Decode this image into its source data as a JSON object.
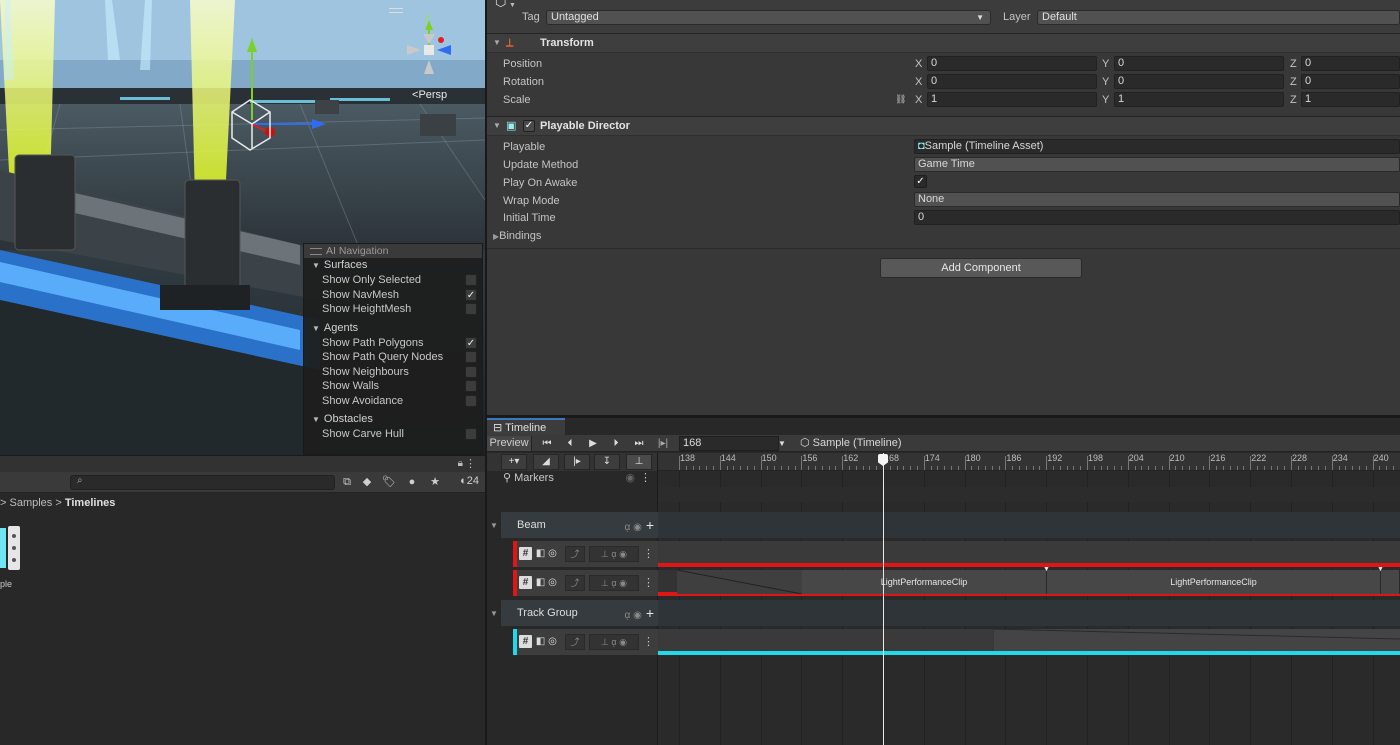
{
  "scene": {
    "persp_label": "Persp",
    "gizmo_axis_label": "y"
  },
  "ai_navigation": {
    "title": "AI Navigation",
    "sections": [
      {
        "label": "Surfaces",
        "rows": [
          {
            "label": "Show Only Selected",
            "checked": false
          },
          {
            "label": "Show NavMesh",
            "checked": true
          },
          {
            "label": "Show HeightMesh",
            "checked": false
          }
        ]
      },
      {
        "label": "Agents",
        "rows": [
          {
            "label": "Show Path Polygons",
            "checked": true
          },
          {
            "label": "Show Path Query Nodes",
            "checked": false
          },
          {
            "label": "Show Neighbours",
            "checked": false
          },
          {
            "label": "Show Walls",
            "checked": false
          },
          {
            "label": "Show Avoidance",
            "checked": false
          }
        ]
      },
      {
        "label": "Obstacles",
        "rows": [
          {
            "label": "Show Carve Hull",
            "checked": false
          }
        ]
      }
    ]
  },
  "project": {
    "search_placeholder": "",
    "hidden_count": "24",
    "breadcrumb": {
      "parent": "Samples",
      "current": "Timelines"
    },
    "asset_label": "ple"
  },
  "inspector": {
    "tag_label": "Tag",
    "tag_value": "Untagged",
    "layer_label": "Layer",
    "layer_value": "Default",
    "transform": {
      "title": "Transform",
      "position": {
        "label": "Position",
        "x": "0",
        "y": "0",
        "z": "0"
      },
      "rotation": {
        "label": "Rotation",
        "x": "0",
        "y": "0",
        "z": "0"
      },
      "scale": {
        "label": "Scale",
        "x": "1",
        "y": "1",
        "z": "1"
      }
    },
    "playable_director": {
      "title": "Playable Director",
      "playable_label": "Playable",
      "playable_value": "Sample (Timeline Asset)",
      "update_method_label": "Update Method",
      "update_method_value": "Game Time",
      "play_on_awake_label": "Play On Awake",
      "play_on_awake": true,
      "wrap_mode_label": "Wrap Mode",
      "wrap_mode_value": "None",
      "initial_time_label": "Initial Time",
      "initial_time_value": "0",
      "bindings_label": "Bindings"
    },
    "add_component_label": "Add Component"
  },
  "timeline": {
    "tab_label": "Timeline",
    "preview_label": "Preview",
    "frame_value": "168",
    "asset_crumb": "Sample (Timeline)",
    "markers_label": "Markers",
    "ruler_ticks": [
      "138",
      "144",
      "150",
      "156",
      "162",
      "168",
      "174",
      "180",
      "186",
      "192",
      "198",
      "204",
      "210",
      "216",
      "222",
      "228",
      "234",
      "240"
    ],
    "playhead_frame": 168,
    "groups": [
      {
        "label": "Beam"
      },
      {
        "label": "Track Group"
      }
    ],
    "clips": [
      {
        "label": "LightPerformanceClip"
      },
      {
        "label": "LightPerformanceClip"
      }
    ],
    "colors": {
      "red_track": "#e01616",
      "cyan_track": "#21d9e8"
    }
  }
}
